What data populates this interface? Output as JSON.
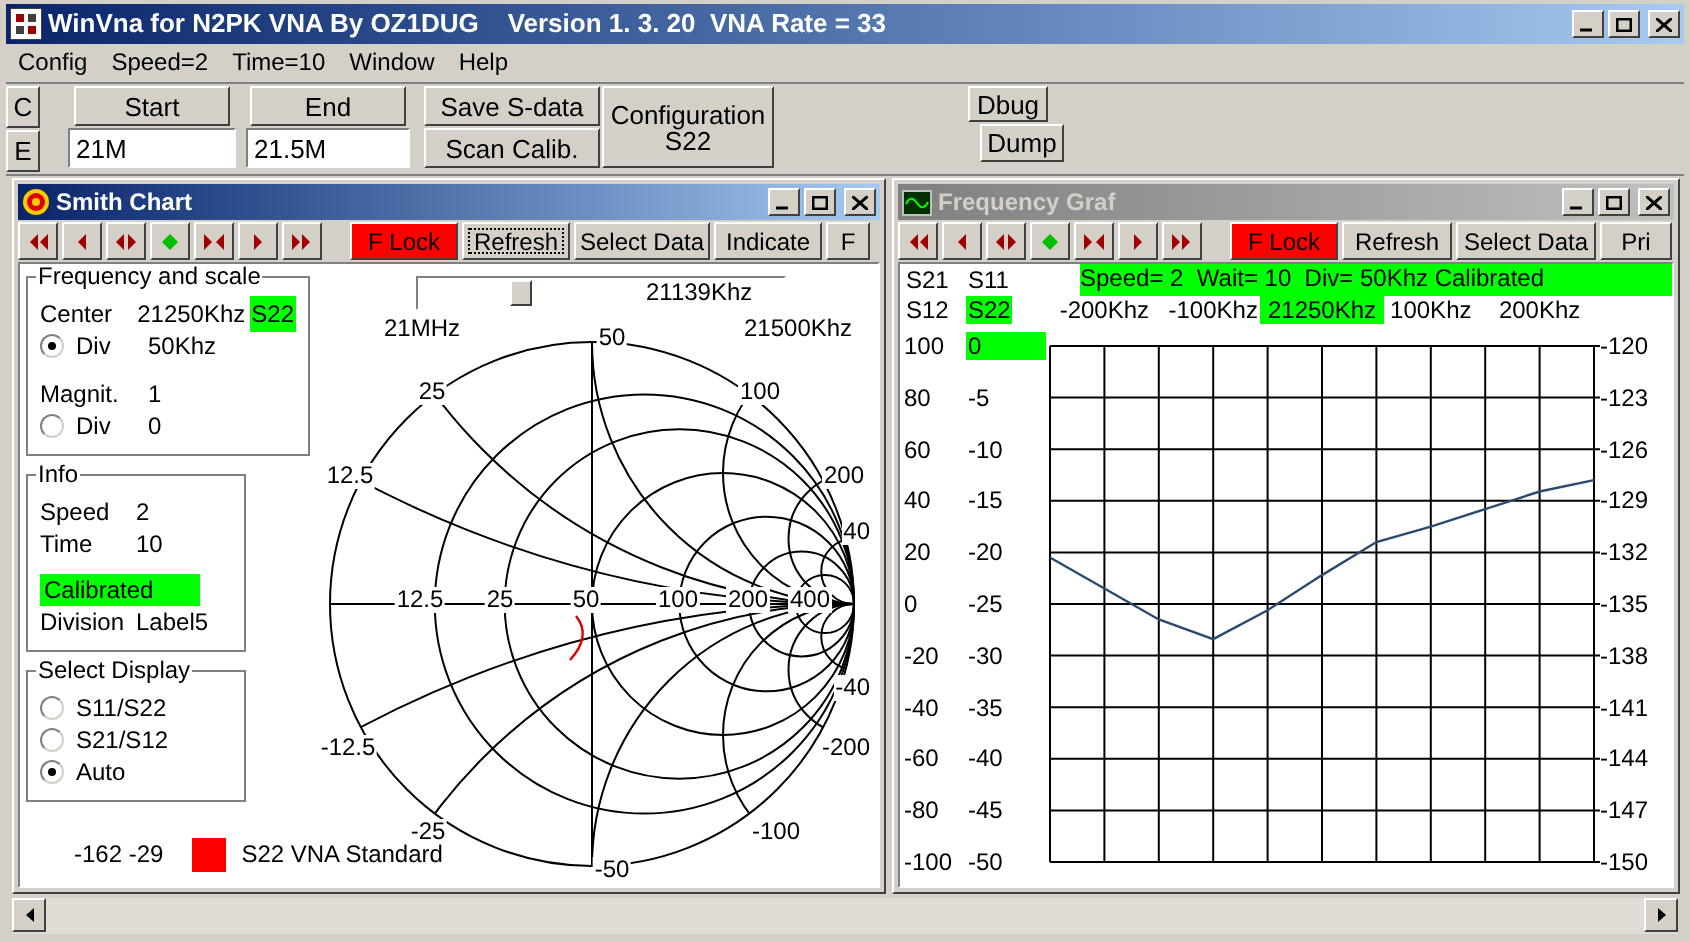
{
  "window": {
    "title": "WinVna for N2PK VNA By OZ1DUG    Version 1. 3. 20  VNA Rate = 33"
  },
  "menu": [
    "Config",
    "Speed=2",
    "Time=10",
    "Window",
    "Help"
  ],
  "toolbar": {
    "side_buttons": [
      "C",
      "E"
    ],
    "start": {
      "button": "Start",
      "value": "21M"
    },
    "end": {
      "button": "End",
      "value": "21.5M"
    },
    "save_button": "Save S-data",
    "scan_button": "Scan Calib.",
    "configuration_button": {
      "line_1": "Configuration",
      "line_2": "S22"
    },
    "dbug_button": "Dbug",
    "dump_button": "Dump"
  },
  "smith_window": {
    "title": "Smith Chart",
    "active": true,
    "tool_buttons": [
      {
        "label": "F Lock",
        "highlighted": true,
        "focused": false
      },
      {
        "label": "Refresh",
        "highlighted": false,
        "focused": true
      },
      {
        "label": "Select Data",
        "highlighted": false,
        "focused": false
      },
      {
        "label": "Indicate",
        "highlighted": false,
        "focused": false
      },
      {
        "label": "F",
        "highlighted": false,
        "focused": false
      }
    ],
    "frequency_and_scale": {
      "title": "Frequency and scale",
      "rows": [
        {
          "kind": "text",
          "label": "Center",
          "value": "21250Khz",
          "badge": "S22"
        },
        {
          "kind": "radio",
          "label": "Div",
          "value": "50Khz",
          "selected": true
        },
        {
          "kind": "text",
          "label": "Magnit.",
          "value": "1"
        },
        {
          "kind": "radio",
          "label": "Div",
          "value": "0",
          "selected": false
        }
      ]
    },
    "info": {
      "title": "Info",
      "rows": [
        {
          "label": "Speed",
          "value": "2"
        },
        {
          "label": "Time",
          "value": "10"
        }
      ],
      "status": "Calibrated",
      "division_label": "Division",
      "division_value": "Label5"
    },
    "select_display": {
      "title": "Select Display",
      "options": [
        {
          "label": "S11/S22",
          "selected": false
        },
        {
          "label": "S21/S12",
          "selected": false
        },
        {
          "label": "Auto",
          "selected": true
        }
      ]
    },
    "footer": {
      "reading": "-162 -29",
      "legend_label": "S22 VNA Standard"
    },
    "slider": {
      "level": 0.28,
      "reading": "21139Khz",
      "min_label": "21MHz",
      "max_label": "21500Khz"
    },
    "smith_chart": {
      "reactance_labels": [
        "50",
        "25",
        "100",
        "12.5",
        "200",
        "40"
      ],
      "resistance_labels": [
        "12.5",
        "25",
        "50",
        "100",
        "200",
        "400"
      ],
      "negative_reactance_labels": [
        "-12.5",
        "-25",
        "-50",
        "-100",
        "-200",
        "-40"
      ]
    }
  },
  "graf_window": {
    "title": "Frequency Graf",
    "active": false,
    "tool_buttons": [
      {
        "label": "F Lock",
        "highlighted": true,
        "focused": false
      },
      {
        "label": "Refresh",
        "highlighted": false,
        "focused": false
      },
      {
        "label": "Select Data",
        "highlighted": false,
        "focused": false
      },
      {
        "label": "Pri",
        "highlighted": false,
        "focused": false
      }
    ],
    "traces": [
      {
        "label": "S21",
        "selected": false
      },
      {
        "label": "S11",
        "selected": false
      },
      {
        "label": "S12",
        "selected": false
      },
      {
        "label": "S22",
        "selected": true
      }
    ],
    "status": "Speed= 2  Wait= 10  Div= 50Khz Calibrated",
    "left_scale": [
      "100",
      "80",
      "60",
      "40",
      "20",
      "0",
      "-20",
      "-40",
      "-60",
      "-80",
      "-100"
    ],
    "right_scale": [
      "-120",
      "-123",
      "-126",
      "-129",
      "-132",
      "-135",
      "-138",
      "-141",
      "-144",
      "-147",
      "-150"
    ],
    "reference_highlighted": true,
    "center_label": "21250Khz",
    "center_label_highlighted": true,
    "chart_data": {
      "type": "line",
      "grid": true,
      "x": [
        -250,
        -200,
        -150,
        -100,
        -50,
        0,
        50,
        100,
        150,
        200,
        250
      ],
      "xlim": [
        -250,
        250
      ],
      "xticks": [
        {
          "value": -200,
          "label": "-200Khz"
        },
        {
          "value": -100,
          "label": "-100Khz"
        },
        {
          "value": 100,
          "label": "100Khz"
        },
        {
          "value": 200,
          "label": "200Khz"
        }
      ],
      "ylim": [
        -50,
        0
      ],
      "yticks": [
        {
          "value": 0,
          "label": "0"
        },
        {
          "value": -5,
          "label": "-5"
        },
        {
          "value": -10,
          "label": "-10"
        },
        {
          "value": -15,
          "label": "-15"
        },
        {
          "value": -20,
          "label": "-20"
        },
        {
          "value": -25,
          "label": "-25"
        },
        {
          "value": -30,
          "label": "-30"
        },
        {
          "value": -35,
          "label": "-35"
        },
        {
          "value": -40,
          "label": "-40"
        },
        {
          "value": -45,
          "label": "-45"
        },
        {
          "value": -50,
          "label": "-50"
        }
      ],
      "series": [
        {
          "color": "#2a4a6e",
          "values": [
            -20.5,
            -23.5,
            -26.5,
            -28.4,
            -25.6,
            -22.2,
            -19.0,
            -17.5,
            -15.8,
            -14.1,
            -13.0
          ]
        }
      ]
    }
  }
}
